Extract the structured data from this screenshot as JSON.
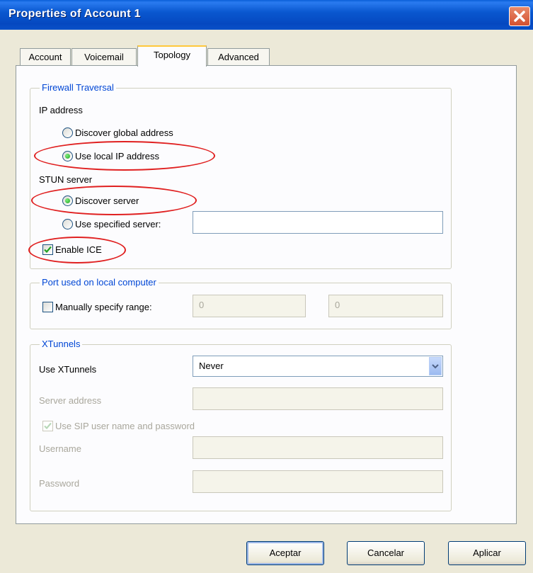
{
  "window": {
    "title": "Properties of Account 1",
    "close_icon": "close-x-icon"
  },
  "tabs": [
    {
      "label": "Account",
      "active": false
    },
    {
      "label": "Voicemail",
      "active": false
    },
    {
      "label": "Topology",
      "active": true
    },
    {
      "label": "Advanced",
      "active": false
    }
  ],
  "firewall": {
    "legend": "Firewall Traversal",
    "ip_label": "IP address",
    "opt_discover_global": "Discover global address",
    "opt_use_local": "Use local IP address",
    "stun_label": "STUN server",
    "opt_discover_server": "Discover server",
    "opt_use_specified": "Use specified server:",
    "specified_value": "",
    "enable_ice": "Enable ICE"
  },
  "port": {
    "legend": "Port used on local computer",
    "manual_label": "Manually specify range:",
    "from": "0",
    "to": "0"
  },
  "xtunnels": {
    "legend": "XTunnels",
    "use_label": "Use XTunnels",
    "use_value": "Never",
    "server_label": "Server address",
    "server_value": "",
    "sip_label": "Use SIP user name and password",
    "username_label": "Username",
    "username_value": "",
    "password_label": "Password",
    "password_value": ""
  },
  "buttons": {
    "ok": "Aceptar",
    "cancel": "Cancelar",
    "apply": "Aplicar"
  },
  "colors": {
    "title_bar": "#0a58d0",
    "annotation": "#e02020",
    "legend": "#0046d5"
  }
}
